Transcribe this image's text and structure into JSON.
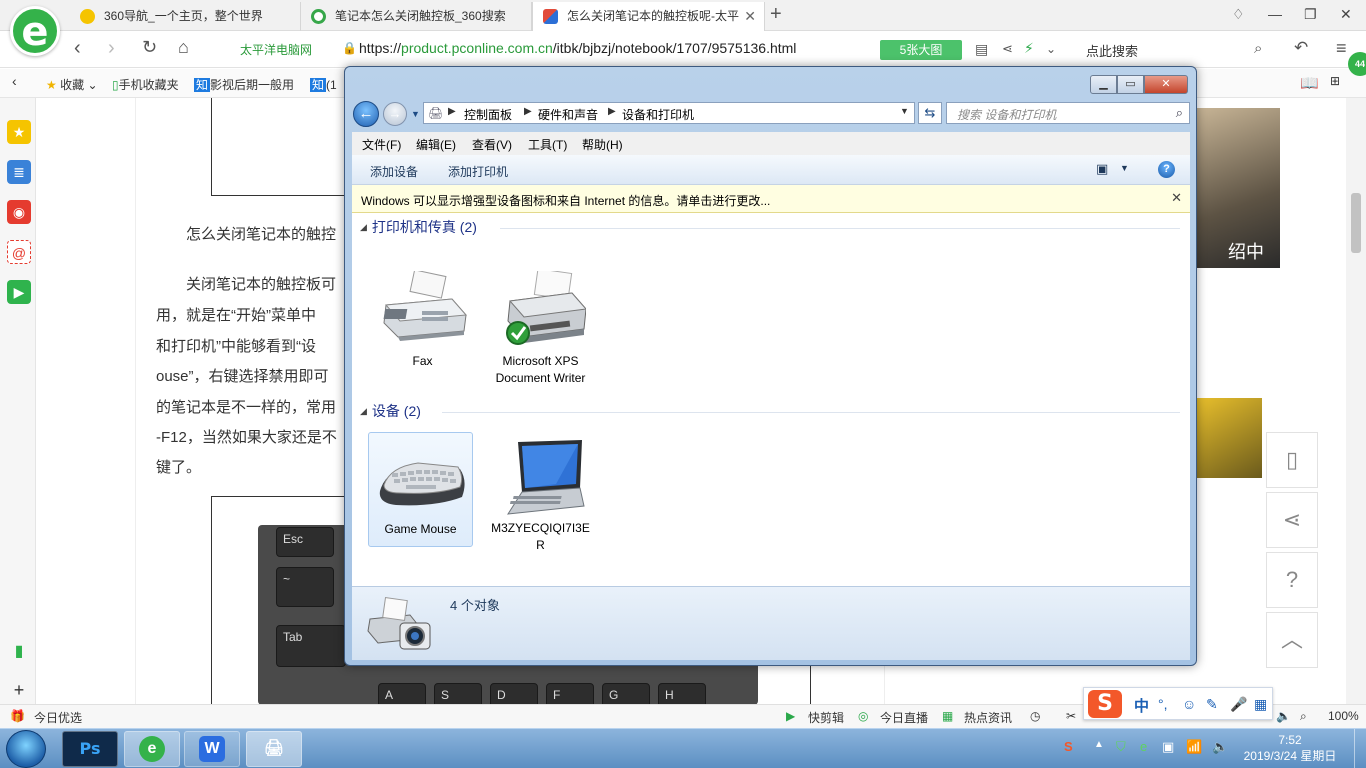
{
  "browser": {
    "tabs": [
      {
        "label": "360导航_一个主页，整个世界",
        "fav_color": "#f5c400"
      },
      {
        "label": "笔记本怎么关闭触控板_360搜索",
        "fav_color": "#37a74a"
      },
      {
        "label": "怎么关闭笔记本的触控板呢-太平",
        "fav_color": "#e14b3a"
      }
    ],
    "site_name": "太平洋电脑网",
    "url_scheme": "https://",
    "url_host": "product.pconline.com.cn",
    "url_path": "/itbk/bjbzj/notebook/1707/9575136.html",
    "big_pics_label": "5张大图",
    "click_search": "点此搜索",
    "bookmarks": [
      "收藏",
      "手机收藏夹",
      "影视后期一般用",
      "(1"
    ],
    "badge_count": "44"
  },
  "article": {
    "line1": "怎么关闭笔记本的触控",
    "line2": "关闭笔记本的触控板可",
    "line3": "用，就是在“开始”菜单中",
    "line4": "和打印机”中能够看到“设",
    "line5": "ouse”，右键选择禁用即可",
    "line6": "的笔记本是不一样的，常用",
    "line7": "-F12，当然如果大家还是不",
    "line8": "键了。",
    "side_caption": "绍中",
    "keys": [
      "Esc",
      "~",
      "Tab",
      "A",
      "S",
      "D",
      "F",
      "G",
      "H"
    ]
  },
  "statusbar": {
    "today": "今日优选",
    "items": [
      "快剪辑",
      "今日直播",
      "热点资讯"
    ],
    "zoom": "100%"
  },
  "ime": {
    "logo": "S",
    "mode": "中"
  },
  "explorer": {
    "breadcrumbs": [
      "控制面板",
      "硬件和声音",
      "设备和打印机"
    ],
    "search_placeholder": "搜索 设备和打印机",
    "menus": [
      "文件(F)",
      "编辑(E)",
      "查看(V)",
      "工具(T)",
      "帮助(H)"
    ],
    "commands": [
      "添加设备",
      "添加打印机"
    ],
    "info_text": "Windows 可以显示增强型设备图标和来自 Internet 的信息。请单击进行更改...",
    "groups": [
      {
        "title": "打印机和传真 (2)",
        "items": [
          {
            "label": "Fax"
          },
          {
            "label": "Microsoft XPS Document Writer"
          }
        ]
      },
      {
        "title": "设备 (2)",
        "items": [
          {
            "label": "Game Mouse"
          },
          {
            "label": "M3ZYECQIQI7I3ER"
          }
        ]
      }
    ],
    "status": "4 个对象"
  },
  "taskbar": {
    "clock_time": "7:52",
    "clock_date": "2019/3/24 星期日"
  }
}
